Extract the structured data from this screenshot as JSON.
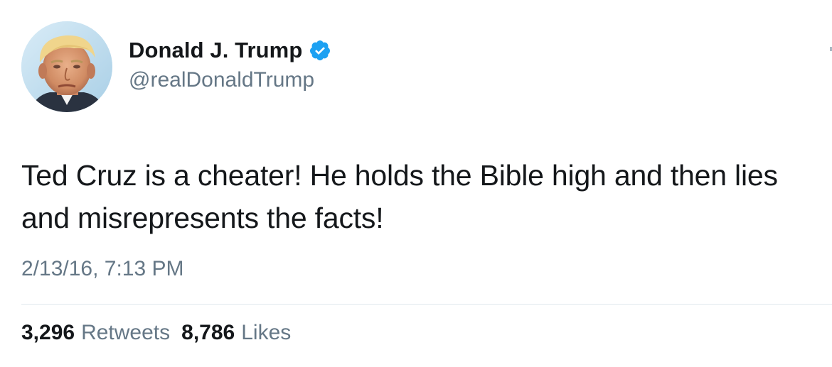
{
  "user": {
    "display_name": "Donald J. Trump",
    "handle": "@realDonaldTrump",
    "verified_icon": "verified-badge-icon",
    "avatar_icon": "profile-photo"
  },
  "tweet": {
    "text": "Ted Cruz is a cheater! He holds the Bible high and then lies and misrepresents the facts!",
    "timestamp": "2/13/16, 7:13 PM"
  },
  "stats": {
    "retweets_count": "3,296",
    "retweets_label": "Retweets",
    "likes_count": "8,786",
    "likes_label": "Likes"
  },
  "colors": {
    "text": "#14171a",
    "secondary": "#657786",
    "verified": "#1da1f2",
    "divider": "#e1e8ed"
  }
}
